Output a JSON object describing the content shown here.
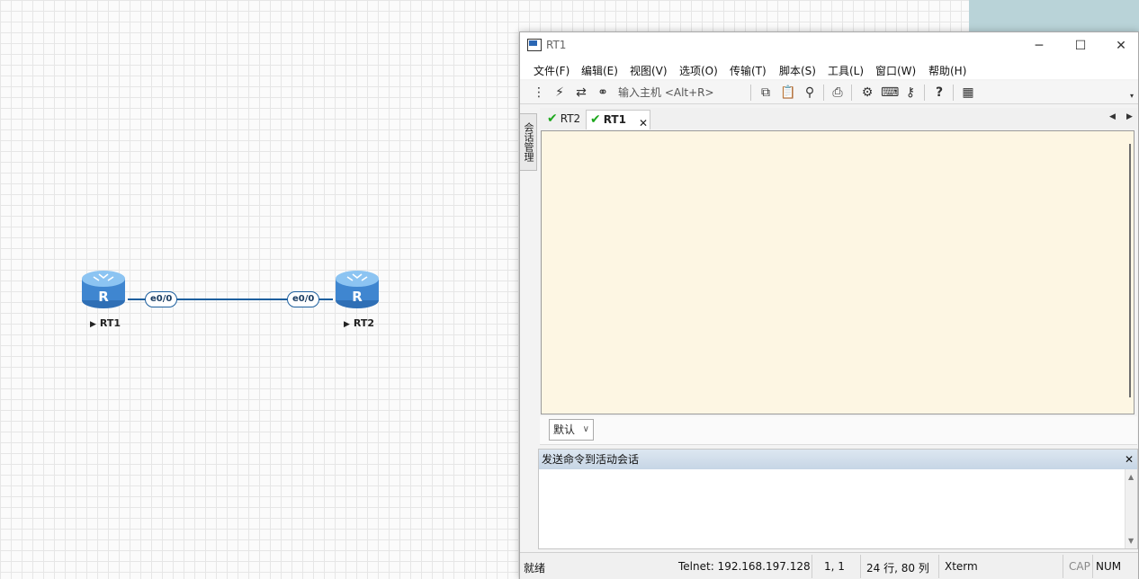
{
  "topology": {
    "routers": [
      {
        "name": "RT1",
        "icon": "router-icon",
        "letter": "R"
      },
      {
        "name": "RT2",
        "icon": "router-icon",
        "letter": "R"
      }
    ],
    "link": {
      "left_port": "e0/0",
      "right_port": "e0/0",
      "color": "#1d5f9e"
    }
  },
  "window": {
    "title": "RT1",
    "controls": {
      "minimize": "─",
      "maximize": "☐",
      "close": "✕"
    }
  },
  "menu": [
    "文件(F)",
    "编辑(E)",
    "视图(V)",
    "选项(O)",
    "传输(T)",
    "脚本(S)",
    "工具(L)",
    "窗口(W)",
    "帮助(H)"
  ],
  "toolbar": {
    "host_placeholder": "输入主机 <Alt+R>",
    "icons": [
      "session-tree-icon",
      "lightning-icon",
      "reconnect-icon",
      "link-icon",
      "copy-icon",
      "paste-icon",
      "find-icon",
      "print-icon",
      "settings-icon",
      "keymap-icon",
      "key-icon",
      "help-icon",
      "map-icon"
    ]
  },
  "side_tab": {
    "label": "会话管理"
  },
  "tabs": [
    {
      "label": "RT2",
      "active": false
    },
    {
      "label": "RT1",
      "active": true
    }
  ],
  "tab_close": "✕",
  "preset": {
    "selected": "默认"
  },
  "send_panel": {
    "title": "发送命令到活动会话",
    "close": "✕"
  },
  "status": {
    "state": "就绪",
    "connection": "Telnet: 192.168.197.128",
    "cursor": "1,   1",
    "size": "24 行, 80 列",
    "terminal_type": "Xterm",
    "cap": "CAP",
    "num": "NUM"
  },
  "colors": {
    "terminal_bg": "#fdf6e3",
    "check_green": "#1ea81e",
    "accent_blue": "#1d5f9e"
  }
}
